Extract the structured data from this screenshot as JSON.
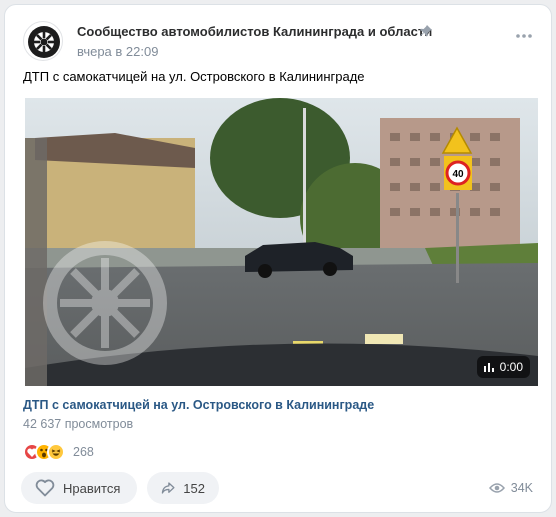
{
  "post": {
    "group_name": "Сообщество автомобилистов Калининграда и области",
    "time": "вчера в 22:09",
    "text": "ДТП с самокатчицей на ул. Островского в Калининграде"
  },
  "video": {
    "duration": "0:00",
    "title": "ДТП с самокатчицей на ул. Островского в Калининграде",
    "views": "42 637 просмотров",
    "road_sign_text": "40"
  },
  "reactions": {
    "icons": [
      "heart-icon",
      "wow-emoji-icon",
      "laugh-emoji-icon"
    ],
    "count": "268"
  },
  "actions": {
    "like_label": "Нравится",
    "share_count": "152",
    "views_total": "34K"
  },
  "colors": {
    "link": "#2a5885",
    "secondary_text": "#818c99",
    "button_bg": "#f0f2f5",
    "heart": "#e64646"
  }
}
